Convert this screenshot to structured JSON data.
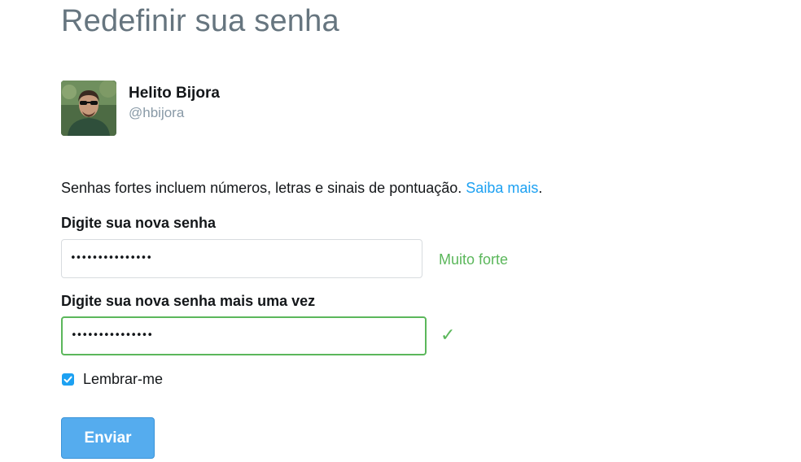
{
  "page": {
    "title": "Redefinir sua senha"
  },
  "user": {
    "name": "Helito Bijora",
    "handle": "@hbijora"
  },
  "hint": {
    "text": "Senhas fortes incluem números, letras e sinais de pontuação.",
    "link_text": "Saiba mais",
    "suffix": "."
  },
  "new_password": {
    "label": "Digite sua nova senha",
    "value": "•••••••••••••••",
    "strength": "Muito forte"
  },
  "confirm_password": {
    "label": "Digite sua nova senha mais uma vez",
    "value": "•••••••••••••••",
    "status_symbol": "✓"
  },
  "remember": {
    "label": "Lembrar-me",
    "checked": true
  },
  "submit": {
    "label": "Enviar"
  },
  "colors": {
    "accent": "#1da1f2",
    "button": "#55acee",
    "success": "#5bb75b",
    "title": "#66757f"
  },
  "icons": {
    "avatar": "user-photo",
    "checkbox": "checkmark-icon",
    "match": "check-icon"
  }
}
